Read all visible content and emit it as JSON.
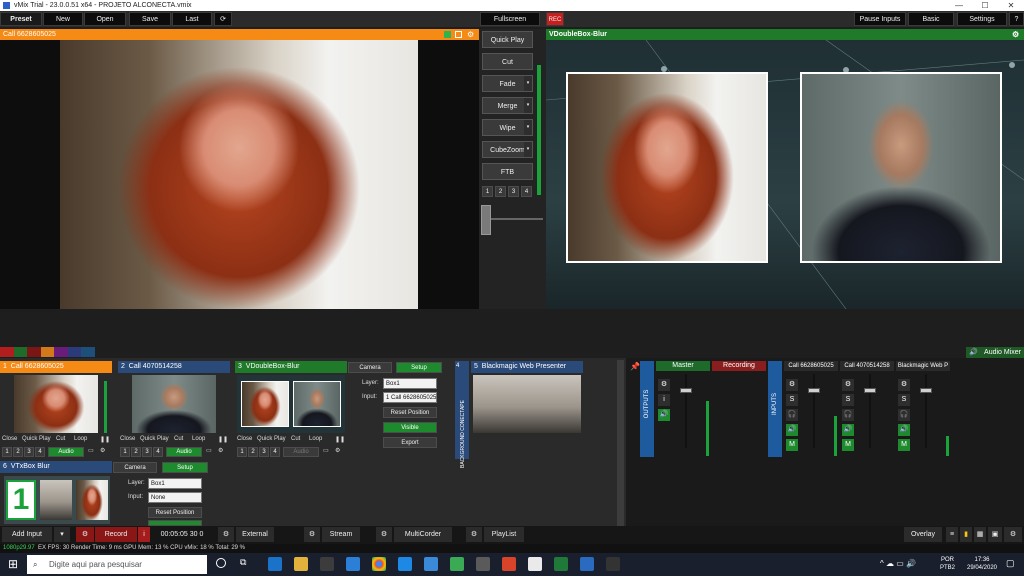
{
  "window": {
    "title": "vMix Trial - 23.0.0.51 x64 - PROJETO ALCONECTA.vmix",
    "minimize": "—",
    "maximize": "☐",
    "close": "✕"
  },
  "menu": {
    "preset": "Preset",
    "new": "New",
    "open": "Open",
    "save": "Save",
    "last": "Last",
    "fullscreen": "Fullscreen",
    "rec_badge": "REC",
    "pause_inputs": "Pause Inputs",
    "basic": "Basic",
    "settings": "Settings",
    "help": "?"
  },
  "preview": {
    "title": "Call 6628605025"
  },
  "output": {
    "title": "VDoubleBox-Blur"
  },
  "transitions": {
    "quick_play": "Quick Play",
    "cut": "Cut",
    "fade": "Fade",
    "merge": "Merge",
    "wipe": "Wipe",
    "cubezoom": "CubeZoom",
    "ftb": "FTB",
    "numbers": [
      "1",
      "2",
      "3",
      "4"
    ]
  },
  "audio_mixer_label": "Audio Mixer",
  "inputs": [
    {
      "num": "1",
      "name": "Call 6628605025",
      "color": "#f58a14"
    },
    {
      "num": "2",
      "name": "Call 4070514258",
      "color": "#2a4a7a"
    },
    {
      "num": "3",
      "name": "VDoubleBox-Blur",
      "color": "#1f7a2a"
    },
    {
      "num": "4",
      "name": "BACKGROUND CONECTAPE",
      "color": "#2a4a7a"
    },
    {
      "num": "5",
      "name": "Blackmagic Web Presenter",
      "color": "#2a4a7a"
    },
    {
      "num": "6",
      "name": "VTxBox Blur",
      "color": "#2a4a7a"
    }
  ],
  "input_controls": {
    "close": "Close",
    "quick_play": "Quick Play",
    "cut": "Cut",
    "loop": "Loop",
    "audio": "Audio",
    "nums": [
      "1",
      "2",
      "3",
      "4"
    ]
  },
  "layer_panel": {
    "camera": "Camera",
    "setup": "Setup",
    "layer_label": "Layer:",
    "layer_value": "Box1",
    "input_label": "Input:",
    "input_value": "1 Call 6628605025",
    "reset_position": "Reset Position",
    "visible": "Visible",
    "export": "Export"
  },
  "layer_panel_6": {
    "camera": "Camera",
    "setup": "Setup",
    "layer_label": "Layer:",
    "layer_value": "Box1",
    "input_label": "Input:",
    "input_value": "None",
    "reset_position": "Reset Position"
  },
  "mixer": {
    "outputs_label": "OUTPUTS",
    "inputs_label": "INPUTS",
    "master": "Master",
    "recording": "Recording",
    "channels": [
      "Call 6628605025",
      "Call 4070514258",
      "Blackmagic Web P"
    ],
    "s_label": "S",
    "m_label": "M",
    "i_label": "i"
  },
  "bottom": {
    "add_input": "Add Input",
    "record": "Record",
    "timecode": "00:05:05 30 0",
    "external": "External",
    "stream": "Stream",
    "multicorder": "MultiCorder",
    "playlist": "PlayList",
    "overlay": "Overlay"
  },
  "status": {
    "format": "1080p29.97",
    "text": "EX  FPS: 30  Render Time: 9 ms  GPU Mem: 13 %  CPU vMix: 18 %  Total: 29 %"
  },
  "taskbar": {
    "search_placeholder": "Digite aqui para pesquisar",
    "lang": "POR",
    "layout": "PTB2",
    "time": "17:36",
    "date": "29/04/2020"
  }
}
